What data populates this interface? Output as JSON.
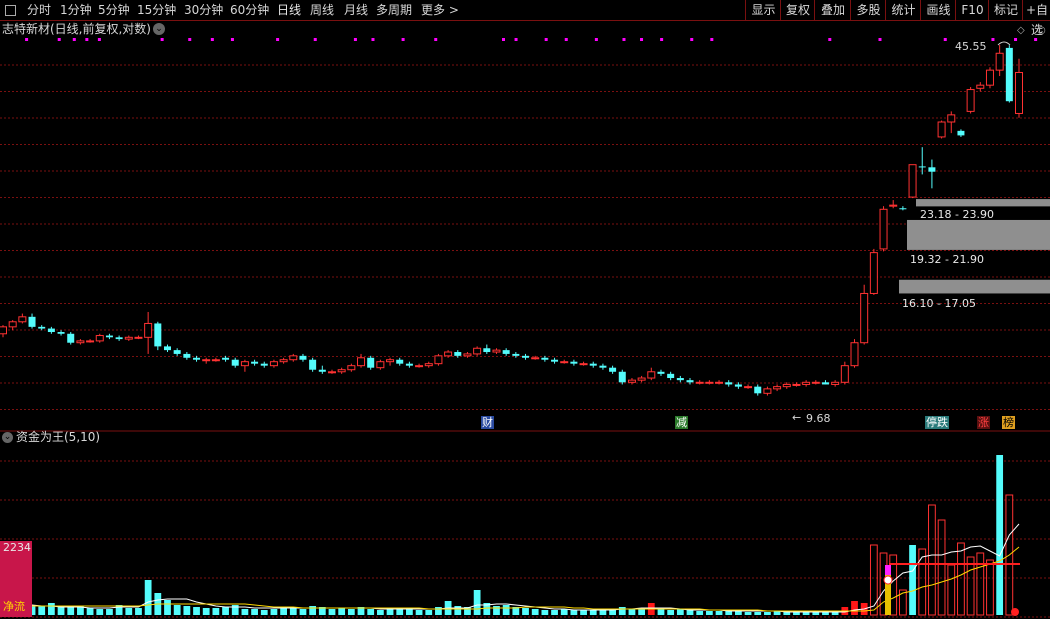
{
  "toolbar": {
    "periods": [
      {
        "label": "分时"
      },
      {
        "label": "1分钟"
      },
      {
        "label": "5分钟"
      },
      {
        "label": "15分钟"
      },
      {
        "label": "30分钟"
      },
      {
        "label": "60分钟"
      },
      {
        "label": "日线",
        "active": true
      },
      {
        "label": "周线"
      },
      {
        "label": "月线"
      },
      {
        "label": "多周期"
      },
      {
        "label": "更多 >"
      }
    ],
    "actions": [
      {
        "label": "显示"
      },
      {
        "label": "复权"
      },
      {
        "label": "叠加"
      },
      {
        "label": "多股"
      },
      {
        "label": "统计"
      },
      {
        "label": "画线"
      },
      {
        "label": "F10"
      },
      {
        "label": "标记"
      },
      {
        "label": "+自选"
      }
    ]
  },
  "kline": {
    "title": "志特新材(日线,前复权,对数)",
    "high_label": "45.55",
    "low_label": "9.68",
    "gap_zones": [
      {
        "label": "23.18 - 23.90"
      },
      {
        "label": "19.32 - 21.90"
      },
      {
        "label": "16.10 - 17.05"
      }
    ],
    "event_markers": [
      "财",
      "减",
      "停跌",
      "涨",
      "榜"
    ],
    "colors": {
      "up": "#ff3232",
      "down": "#54fcfc",
      "gap_zone": "#8f8f8f",
      "grid": "#7a1010",
      "marker": "#ff00ff"
    }
  },
  "indicator": {
    "title": "资金为王(5,10)",
    "left_value": "2234",
    "left_label": "净流"
  },
  "chart_data": {
    "type": "candlestick",
    "scale": "log",
    "ylim": [
      9.0,
      50.0
    ],
    "candles": [
      [
        13.6,
        14.1,
        13.4,
        14.0
      ],
      [
        14.0,
        14.4,
        13.8,
        14.3
      ],
      [
        14.3,
        14.8,
        14.2,
        14.6
      ],
      [
        14.6,
        14.8,
        13.9,
        14.0
      ],
      [
        14.0,
        14.1,
        13.8,
        13.9
      ],
      [
        13.9,
        14.0,
        13.6,
        13.7
      ],
      [
        13.7,
        13.8,
        13.5,
        13.6
      ],
      [
        13.6,
        13.7,
        13.0,
        13.1
      ],
      [
        13.1,
        13.3,
        13.0,
        13.2
      ],
      [
        13.2,
        13.3,
        13.1,
        13.2
      ],
      [
        13.2,
        13.6,
        13.1,
        13.5
      ],
      [
        13.5,
        13.6,
        13.3,
        13.4
      ],
      [
        13.4,
        13.5,
        13.2,
        13.3
      ],
      [
        13.3,
        13.5,
        13.2,
        13.4
      ],
      [
        13.4,
        13.5,
        13.3,
        13.4
      ],
      [
        13.4,
        14.9,
        12.5,
        14.2
      ],
      [
        14.2,
        14.3,
        12.7,
        12.9
      ],
      [
        12.9,
        13.0,
        12.6,
        12.7
      ],
      [
        12.7,
        12.8,
        12.4,
        12.5
      ],
      [
        12.5,
        12.6,
        12.2,
        12.3
      ],
      [
        12.3,
        12.4,
        12.1,
        12.2
      ],
      [
        12.2,
        12.3,
        12.0,
        12.2
      ],
      [
        12.2,
        12.3,
        12.1,
        12.2
      ],
      [
        12.3,
        12.4,
        12.1,
        12.2
      ],
      [
        12.2,
        12.3,
        11.8,
        11.9
      ],
      [
        11.9,
        12.2,
        11.6,
        12.1
      ],
      [
        12.1,
        12.2,
        11.9,
        12.0
      ],
      [
        12.0,
        12.1,
        11.8,
        11.9
      ],
      [
        11.9,
        12.2,
        11.8,
        12.1
      ],
      [
        12.1,
        12.3,
        12.0,
        12.2
      ],
      [
        12.2,
        12.5,
        12.1,
        12.4
      ],
      [
        12.4,
        12.5,
        12.1,
        12.2
      ],
      [
        12.2,
        12.3,
        11.6,
        11.7
      ],
      [
        11.7,
        11.9,
        11.5,
        11.6
      ],
      [
        11.6,
        11.7,
        11.5,
        11.6
      ],
      [
        11.6,
        11.8,
        11.5,
        11.7
      ],
      [
        11.7,
        12.0,
        11.6,
        11.9
      ],
      [
        11.9,
        12.5,
        11.8,
        12.3
      ],
      [
        12.3,
        12.4,
        11.7,
        11.8
      ],
      [
        11.8,
        12.2,
        11.7,
        12.1
      ],
      [
        12.1,
        12.3,
        11.9,
        12.2
      ],
      [
        12.2,
        12.3,
        11.9,
        12.0
      ],
      [
        12.0,
        12.1,
        11.8,
        11.9
      ],
      [
        11.9,
        12.0,
        11.8,
        11.9
      ],
      [
        11.9,
        12.1,
        11.8,
        12.0
      ],
      [
        12.0,
        12.5,
        11.9,
        12.4
      ],
      [
        12.4,
        12.7,
        12.3,
        12.6
      ],
      [
        12.6,
        12.7,
        12.3,
        12.4
      ],
      [
        12.4,
        12.6,
        12.3,
        12.5
      ],
      [
        12.5,
        12.9,
        12.4,
        12.8
      ],
      [
        12.8,
        13.0,
        12.5,
        12.6
      ],
      [
        12.6,
        12.8,
        12.5,
        12.7
      ],
      [
        12.7,
        12.8,
        12.4,
        12.5
      ],
      [
        12.5,
        12.6,
        12.3,
        12.4
      ],
      [
        12.4,
        12.5,
        12.2,
        12.3
      ],
      [
        12.3,
        12.4,
        12.2,
        12.3
      ],
      [
        12.3,
        12.4,
        12.1,
        12.2
      ],
      [
        12.2,
        12.3,
        12.0,
        12.1
      ],
      [
        12.1,
        12.2,
        12.0,
        12.1
      ],
      [
        12.1,
        12.2,
        11.9,
        12.0
      ],
      [
        12.0,
        12.1,
        11.9,
        12.0
      ],
      [
        12.0,
        12.1,
        11.8,
        11.9
      ],
      [
        11.9,
        12.0,
        11.7,
        11.8
      ],
      [
        11.8,
        11.9,
        11.5,
        11.6
      ],
      [
        11.6,
        11.7,
        11.0,
        11.1
      ],
      [
        11.1,
        11.3,
        11.0,
        11.2
      ],
      [
        11.2,
        11.4,
        11.1,
        11.3
      ],
      [
        11.3,
        11.8,
        11.2,
        11.6
      ],
      [
        11.6,
        11.7,
        11.4,
        11.5
      ],
      [
        11.5,
        11.6,
        11.2,
        11.3
      ],
      [
        11.3,
        11.4,
        11.1,
        11.2
      ],
      [
        11.2,
        11.3,
        11.0,
        11.1
      ],
      [
        11.1,
        11.2,
        11.0,
        11.1
      ],
      [
        11.1,
        11.2,
        11.0,
        11.1
      ],
      [
        11.1,
        11.2,
        11.0,
        11.1
      ],
      [
        11.1,
        11.2,
        10.9,
        11.0
      ],
      [
        11.0,
        11.1,
        10.8,
        10.9
      ],
      [
        10.9,
        11.0,
        10.8,
        10.9
      ],
      [
        10.9,
        11.0,
        10.5,
        10.6
      ],
      [
        10.6,
        10.9,
        10.5,
        10.8
      ],
      [
        10.8,
        11.0,
        10.7,
        10.9
      ],
      [
        10.9,
        11.1,
        10.8,
        11.0
      ],
      [
        11.0,
        11.1,
        10.9,
        11.0
      ],
      [
        11.0,
        11.2,
        10.9,
        11.1
      ],
      [
        11.1,
        11.2,
        11.0,
        11.1
      ],
      [
        11.1,
        11.2,
        11.0,
        11.0
      ],
      [
        11.0,
        11.2,
        10.9,
        11.1
      ],
      [
        11.1,
        12.1,
        11.0,
        11.9
      ],
      [
        11.9,
        13.3,
        11.8,
        13.1
      ],
      [
        13.1,
        16.7,
        13.0,
        16.1
      ],
      [
        16.1,
        19.4,
        16.0,
        19.1
      ],
      [
        19.4,
        23.2,
        19.2,
        22.9
      ],
      [
        23.2,
        23.8,
        23.0,
        23.3
      ],
      [
        23.0,
        23.2,
        22.8,
        22.9
      ],
      [
        24.1,
        27.6,
        24.0,
        27.6
      ],
      [
        27.4,
        29.7,
        26.5,
        27.3
      ],
      [
        27.3,
        28.2,
        25.0,
        26.8
      ],
      [
        31.0,
        33.2,
        30.8,
        33.0
      ],
      [
        33.0,
        34.5,
        31.5,
        34.0
      ],
      [
        31.8,
        32.0,
        31.0,
        31.2
      ],
      [
        34.5,
        38.2,
        34.2,
        37.8
      ],
      [
        38.0,
        39.0,
        37.5,
        38.5
      ],
      [
        38.5,
        41.5,
        38.0,
        41.0
      ],
      [
        41.0,
        45.55,
        40.0,
        44.0
      ],
      [
        45.0,
        45.5,
        35.8,
        36.0
      ],
      [
        34.2,
        43.0,
        33.6,
        40.6
      ]
    ],
    "flow_bars": [
      [
        1,
        1,
        1,
        1,
        1
      ],
      [
        1,
        1,
        1,
        1,
        1
      ],
      [
        1,
        1,
        1,
        1,
        1
      ],
      [
        1,
        1,
        1,
        1,
        1
      ],
      [
        1,
        1,
        1,
        1,
        1
      ],
      [
        1,
        1,
        1,
        1,
        1
      ],
      [
        1,
        1,
        1,
        1,
        1
      ],
      [
        1,
        1,
        1,
        1,
        1
      ],
      [
        1,
        1,
        1,
        1,
        1
      ],
      [
        1,
        1,
        1,
        1,
        1
      ],
      [
        1,
        1,
        1,
        1,
        1
      ],
      [
        1,
        1,
        1,
        1,
        1
      ],
      [
        1,
        1,
        1,
        1,
        1
      ],
      [
        1,
        1,
        1,
        1,
        1
      ],
      [
        1,
        1,
        1,
        1,
        1
      ],
      [
        1,
        1,
        1,
        1,
        1
      ],
      [
        1,
        1,
        1,
        1,
        1
      ],
      [
        1,
        1,
        1,
        1,
        1
      ],
      [
        1,
        1,
        1,
        1,
        1
      ],
      [
        1,
        1,
        1,
        1,
        1
      ],
      [
        1,
        1,
        1,
        1,
        1
      ]
    ],
    "flow": {
      "bars": [
        12,
        -11,
        14,
        -10,
        -9,
        -12,
        -8,
        -8,
        -9,
        -7,
        -6,
        -6,
        -10,
        -7,
        -7,
        -35,
        -22,
        -15,
        -10,
        -9,
        -8,
        -7,
        -7,
        -8,
        -10,
        -6,
        -6,
        -5,
        -6,
        -7,
        -8,
        -6,
        -9,
        -8,
        -6,
        -7,
        -6,
        -8,
        -6,
        -5,
        -6,
        -7,
        -6,
        -5,
        -5,
        -8,
        -14,
        -9,
        -8,
        -25,
        -12,
        -9,
        -10,
        -8,
        -7,
        -6,
        -5,
        -5,
        -6,
        -5,
        -5,
        -5,
        -5,
        -6,
        -8,
        -6,
        -7,
        12,
        -6,
        -5,
        -6,
        -5,
        -4,
        -4,
        -4,
        -4,
        -4,
        -3,
        -3,
        -3,
        -4,
        -3,
        -4,
        -3,
        -3,
        -3,
        -3,
        8,
        14,
        12,
        70,
        62,
        60,
        25,
        -70,
        66,
        110,
        95,
        50,
        72,
        58,
        62,
        55,
        -160,
        120
      ],
      "ma5": [
        10,
        10,
        11,
        10,
        9,
        9,
        8,
        8,
        8,
        7,
        7,
        7,
        8,
        8,
        8,
        13,
        15,
        16,
        16,
        16,
        13,
        11,
        9,
        8,
        8,
        8,
        7,
        7,
        7,
        7,
        7,
        7,
        7,
        7,
        7,
        7,
        7,
        7,
        7,
        6,
        6,
        6,
        6,
        6,
        6,
        6,
        7,
        7,
        7,
        10,
        10,
        11,
        11,
        10,
        9,
        8,
        7,
        6,
        6,
        5,
        5,
        5,
        5,
        5,
        6,
        6,
        7,
        7,
        7,
        7,
        6,
        5,
        5,
        5,
        5,
        4,
        4,
        4,
        4,
        4,
        4,
        3,
        3,
        3,
        3,
        3,
        3,
        3,
        5,
        6,
        9,
        24,
        34,
        42,
        44,
        58,
        60,
        60,
        63,
        64,
        68,
        69,
        64,
        59,
        80,
        91
      ],
      "ma10": [
        9,
        9,
        9,
        9,
        9,
        9,
        9,
        9,
        9,
        9,
        9,
        9,
        9,
        9,
        9,
        10,
        11,
        11,
        11,
        11,
        11,
        11,
        11,
        11,
        11,
        11,
        10,
        9,
        8,
        8,
        8,
        7,
        7,
        7,
        7,
        7,
        7,
        7,
        7,
        7,
        7,
        7,
        7,
        7,
        6,
        6,
        6,
        6,
        6,
        6,
        7,
        7,
        7,
        7,
        8,
        8,
        8,
        8,
        8,
        7,
        7,
        6,
        6,
        6,
        6,
        6,
        6,
        6,
        6,
        6,
        6,
        6,
        6,
        5,
        5,
        5,
        5,
        5,
        5,
        4,
        4,
        4,
        4,
        4,
        4,
        4,
        4,
        4,
        4,
        4,
        5,
        13,
        17,
        22,
        24,
        28,
        30,
        33,
        36,
        40,
        45,
        48,
        51,
        54,
        60,
        68
      ]
    }
  }
}
